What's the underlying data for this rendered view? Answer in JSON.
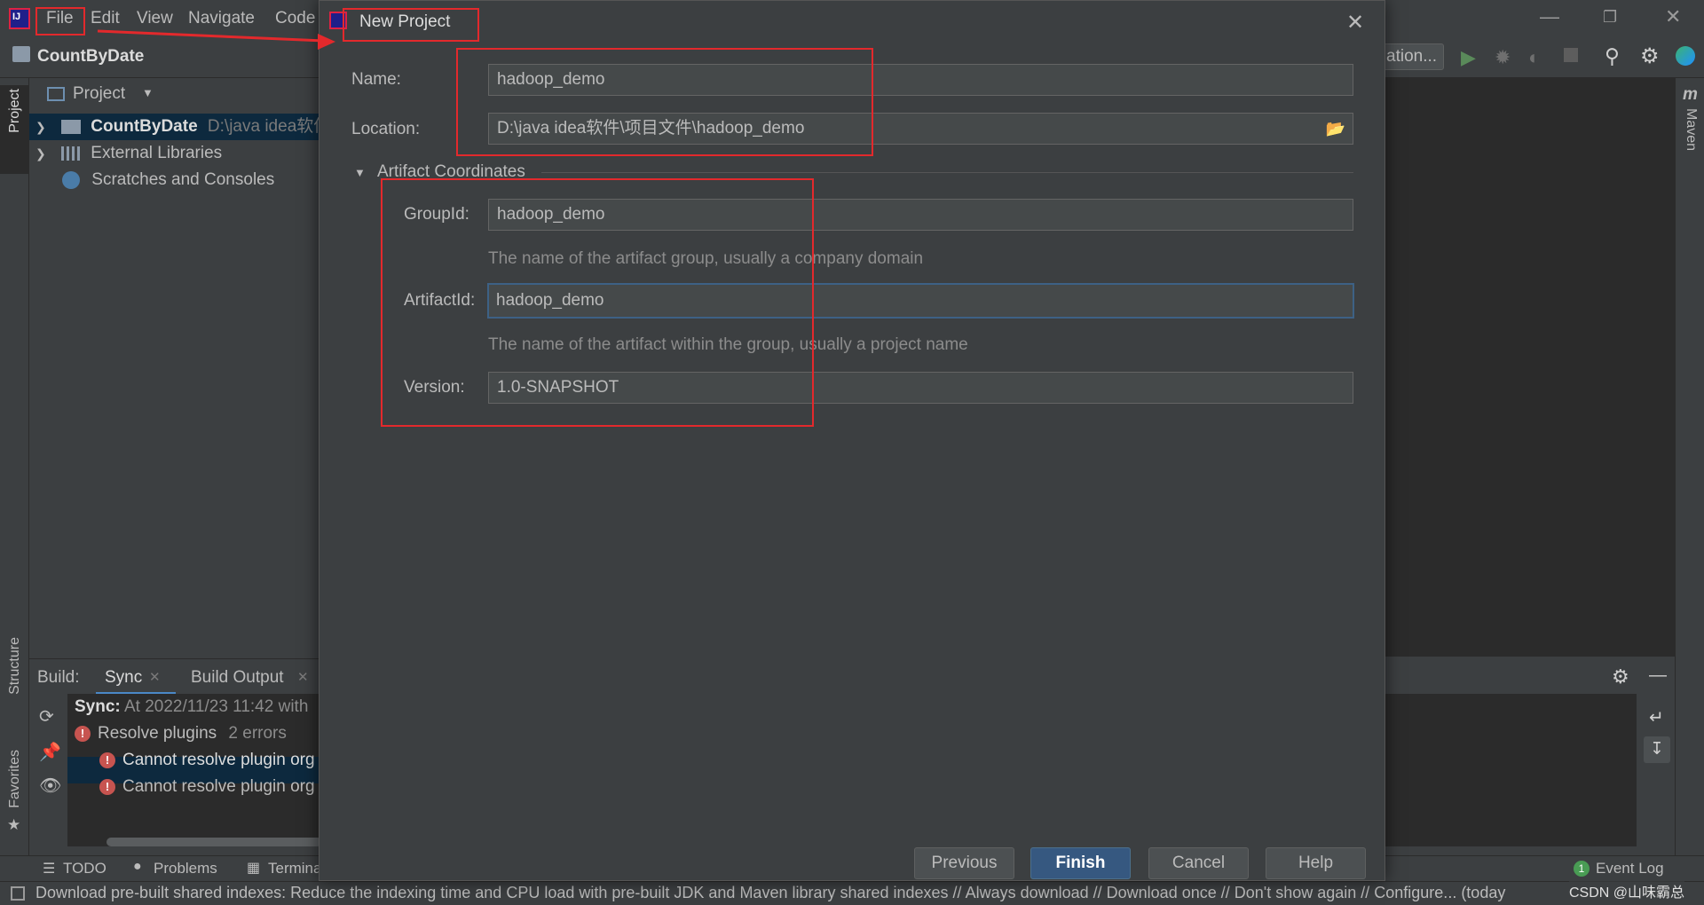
{
  "menu": {
    "items": [
      "File",
      "Edit",
      "View",
      "Navigate",
      "Code"
    ]
  },
  "navbar": {
    "project": "CountByDate",
    "run_config": "ation..."
  },
  "left_strip": {
    "project": "Project",
    "structure": "Structure",
    "favorites": "Favorites"
  },
  "right_strip": {
    "maven": "Maven"
  },
  "project_panel": {
    "header": "Project",
    "items": [
      {
        "label": "CountByDate",
        "path": "D:\\java idea软件"
      },
      {
        "label": "External Libraries"
      },
      {
        "label": "Scratches and Consoles"
      }
    ]
  },
  "build_panel": {
    "label": "Build:",
    "tabs": [
      "Sync",
      "Build Output"
    ],
    "sync_title": "Sync:",
    "sync_text": "At 2022/11/23 11:42 with",
    "resolve": "Resolve plugins",
    "resolve_count": "2 errors",
    "errors": [
      "Cannot resolve plugin org",
      "Cannot resolve plugin org"
    ]
  },
  "dialog": {
    "title": "New Project",
    "name_label": "Name:",
    "name_value": "hadoop_demo",
    "location_label": "Location:",
    "location_value": "D:\\java idea软件\\项目文件\\hadoop_demo",
    "section": "Artifact Coordinates",
    "groupid_label": "GroupId:",
    "groupid_value": "hadoop_demo",
    "groupid_hint": "The name of the artifact group, usually a company domain",
    "artifactid_label": "ArtifactId:",
    "artifactid_value": "hadoop_demo",
    "artifactid_hint": "The name of the artifact within the group, usually a project name",
    "version_label": "Version:",
    "version_value": "1.0-SNAPSHOT",
    "buttons": {
      "previous": "Previous",
      "finish": "Finish",
      "cancel": "Cancel",
      "help": "Help"
    }
  },
  "bottom_toolbar": {
    "todo": "TODO",
    "problems": "Problems",
    "terminal": "Termina",
    "event_log": "Event Log",
    "event_count": "1"
  },
  "status_bar": {
    "text": "Download pre-built shared indexes: Reduce the indexing time and CPU load with pre-built JDK and Maven library shared indexes // Always download // Download once // Don't show again // Configure... (today",
    "watermark": "CSDN @山味霸总"
  },
  "colors": {
    "annotation_red": "#e3292c",
    "accent_blue": "#365880",
    "error_red": "#c75450"
  }
}
